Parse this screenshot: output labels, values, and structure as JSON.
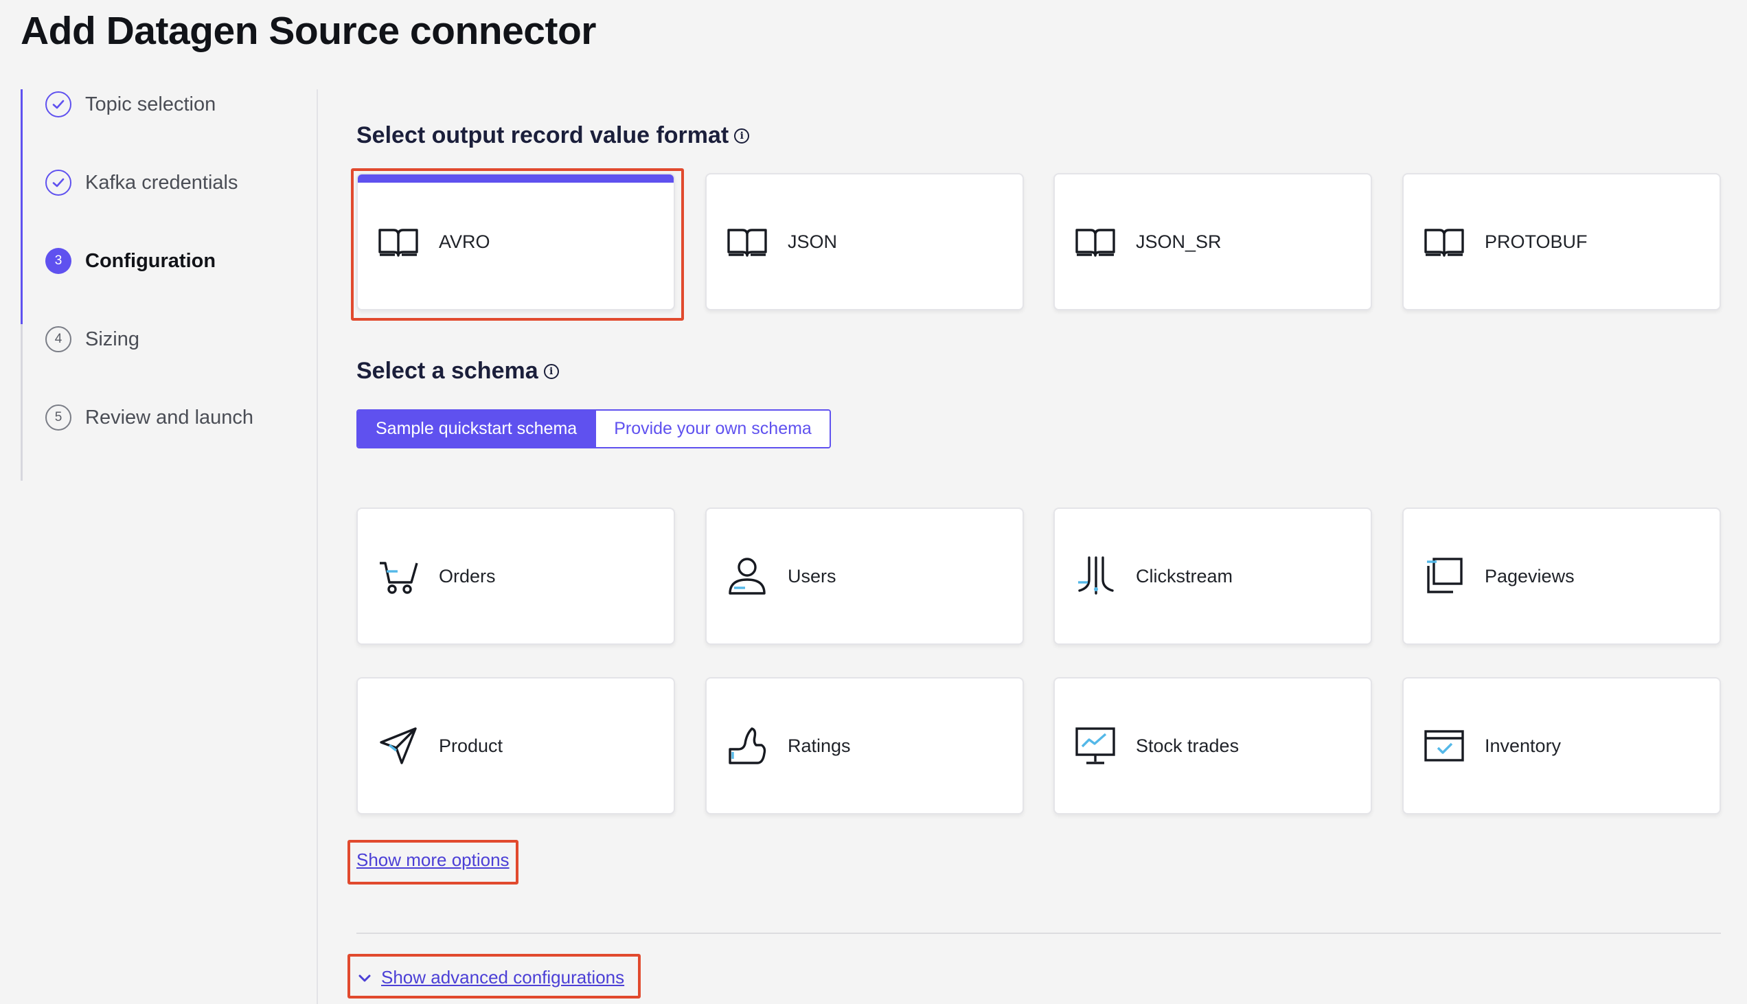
{
  "page_title": "Add Datagen Source connector",
  "stepper": {
    "steps": [
      {
        "label": "Topic selection",
        "state": "done",
        "number": ""
      },
      {
        "label": "Kafka credentials",
        "state": "done",
        "number": ""
      },
      {
        "label": "Configuration",
        "state": "current",
        "number": "3"
      },
      {
        "label": "Sizing",
        "state": "todo",
        "number": "4"
      },
      {
        "label": "Review and launch",
        "state": "todo",
        "number": "5"
      }
    ]
  },
  "format_section": {
    "title": "Select output record value format",
    "options": [
      {
        "label": "AVRO",
        "icon": "book-icon",
        "selected": true
      },
      {
        "label": "JSON",
        "icon": "book-icon",
        "selected": false
      },
      {
        "label": "JSON_SR",
        "icon": "book-icon",
        "selected": false
      },
      {
        "label": "PROTOBUF",
        "icon": "book-icon",
        "selected": false
      }
    ]
  },
  "schema_section": {
    "title": "Select a schema",
    "toggle": {
      "quickstart": "Sample quickstart schema",
      "own": "Provide your own schema",
      "selected": "quickstart"
    },
    "options": [
      {
        "label": "Orders",
        "icon": "cart-icon"
      },
      {
        "label": "Users",
        "icon": "user-icon"
      },
      {
        "label": "Clickstream",
        "icon": "clickstream-icon"
      },
      {
        "label": "Pageviews",
        "icon": "pageviews-icon"
      },
      {
        "label": "Product",
        "icon": "send-icon"
      },
      {
        "label": "Ratings",
        "icon": "ratings-icon"
      },
      {
        "label": "Stock trades",
        "icon": "stock-monitor-icon"
      },
      {
        "label": "Inventory",
        "icon": "inventory-icon"
      }
    ]
  },
  "links": {
    "show_more": "Show more options",
    "show_advanced": "Show advanced configurations"
  },
  "colors": {
    "accent": "#5f51ef",
    "highlight": "#e14a2e",
    "icon_light": "#54b8e8"
  }
}
